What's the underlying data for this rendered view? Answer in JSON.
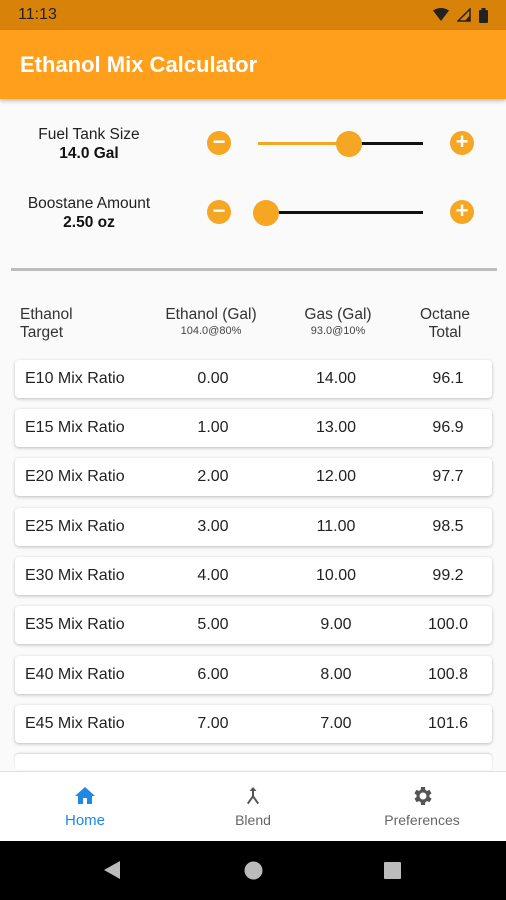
{
  "status": {
    "time": "11:13"
  },
  "app": {
    "title": "Ethanol Mix Calculator"
  },
  "sliders": [
    {
      "name": "Fuel Tank Size",
      "value": "14.0 Gal",
      "level": 0.55
    },
    {
      "name": "Boostane Amount",
      "value": "2.50 oz",
      "level": 0.05
    }
  ],
  "controls": {
    "minus": "−",
    "plus": "+"
  },
  "table": {
    "headers": {
      "target": "Ethanol Target",
      "ethanol": "Ethanol (Gal)",
      "ethanol_sub": "104.0@80%",
      "gas": "Gas (Gal)",
      "gas_sub": "93.0@10%",
      "octane": "Octane Total"
    },
    "rows": [
      {
        "label": "E10 Mix Ratio",
        "ethanol": "0.00",
        "gas": "14.00",
        "octane": "96.1"
      },
      {
        "label": "E15 Mix Ratio",
        "ethanol": "1.00",
        "gas": "13.00",
        "octane": "96.9"
      },
      {
        "label": "E20 Mix Ratio",
        "ethanol": "2.00",
        "gas": "12.00",
        "octane": "97.7"
      },
      {
        "label": "E25 Mix Ratio",
        "ethanol": "3.00",
        "gas": "11.00",
        "octane": "98.5"
      },
      {
        "label": "E30 Mix Ratio",
        "ethanol": "4.00",
        "gas": "10.00",
        "octane": "99.2"
      },
      {
        "label": "E35 Mix Ratio",
        "ethanol": "5.00",
        "gas": "9.00",
        "octane": "100.0"
      },
      {
        "label": "E40 Mix Ratio",
        "ethanol": "6.00",
        "gas": "8.00",
        "octane": "100.8"
      },
      {
        "label": "E45 Mix Ratio",
        "ethanol": "7.00",
        "gas": "7.00",
        "octane": "101.6"
      }
    ]
  },
  "nav": {
    "home": "Home",
    "blend": "Blend",
    "preferences": "Preferences",
    "icons": {
      "home": "home-icon",
      "blend": "merge-icon",
      "preferences": "gear-icon"
    }
  },
  "colors": {
    "accent": "#ff9f1c",
    "status": "#d9820a",
    "active_nav": "#1e88e5"
  }
}
